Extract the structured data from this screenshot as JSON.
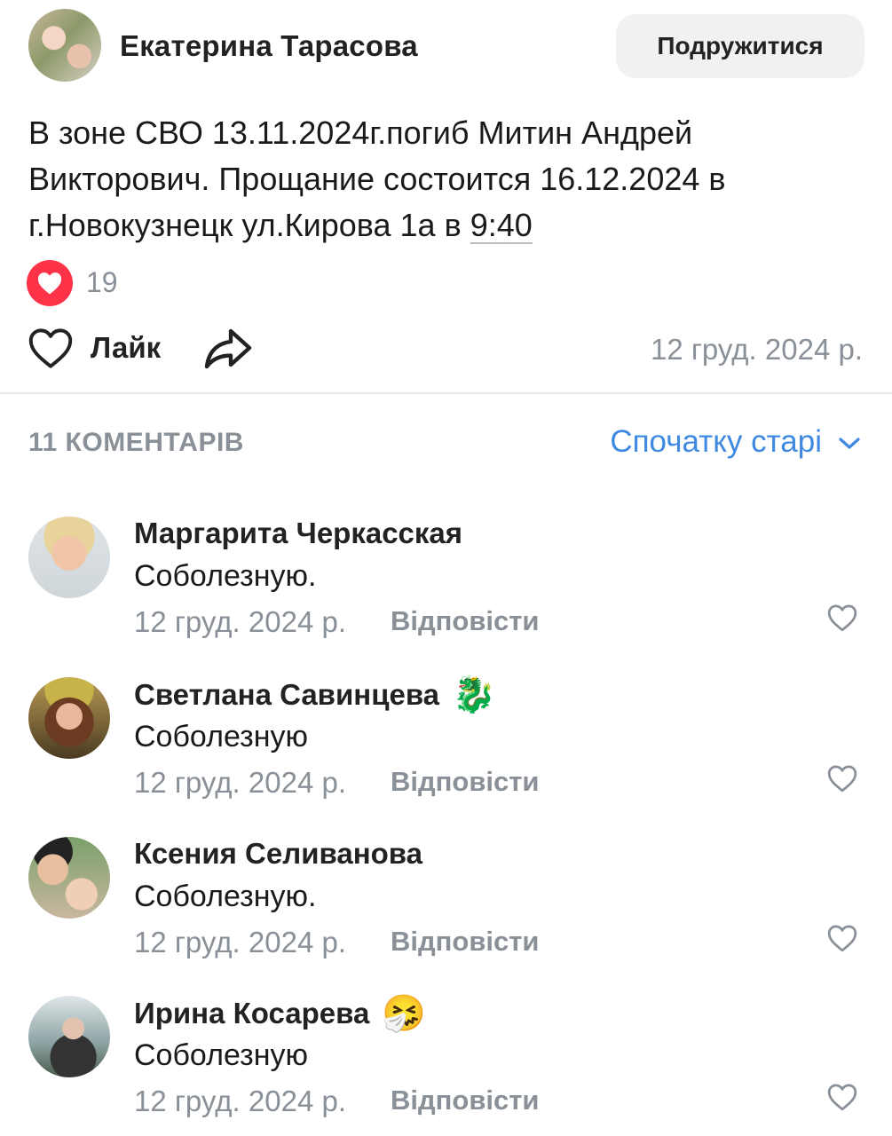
{
  "post": {
    "author": "Екатерина Тарасова",
    "friend_button": "Подружитися",
    "text_before_link": "В зоне СВО 13.11.2024г.погиб Митин Андрей Викторович. Прощание состоится 16.12.2024 в г.Новокузнецк ул.Кирова 1а в ",
    "text_link": "9:40",
    "reaction_count": "19",
    "like_label": "Лайк",
    "date": "12 груд. 2024 р."
  },
  "comments_section": {
    "count_label": "11 КОМЕНТАРІВ",
    "sort_label": "Спочатку старі"
  },
  "comments": [
    {
      "author": "Маргарита Черкасская",
      "emoji": "",
      "text": "Соболезную.",
      "date": "12 груд. 2024 р.",
      "reply": "Відповісти"
    },
    {
      "author": "Светлана Савинцева",
      "emoji": "🐉",
      "text": "Соболезную",
      "date": "12 груд. 2024 р.",
      "reply": "Відповісти"
    },
    {
      "author": "Ксения Селиванова",
      "emoji": "",
      "text": "Соболезную.",
      "date": "12 груд. 2024 р.",
      "reply": "Відповісти"
    },
    {
      "author": "Ирина Косарева",
      "emoji": "🤧",
      "text": "Соболезную",
      "date": "12 груд. 2024 р.",
      "reply": "Відповісти"
    }
  ],
  "colors": {
    "accent": "#3f8ae0",
    "reaction_heart": "#ff3347",
    "secondary_text": "#8a9098"
  },
  "icons": [
    "heart-icon",
    "share-icon",
    "chevron-down-icon"
  ]
}
